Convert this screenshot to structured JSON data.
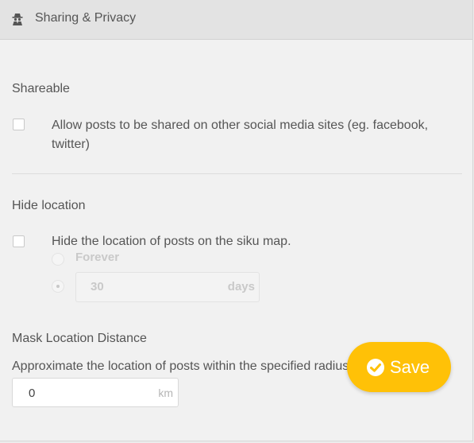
{
  "header": {
    "title": "Sharing & Privacy",
    "icon": "spy-icon"
  },
  "shareable": {
    "title": "Shareable",
    "checkbox_label_line1": "Allow posts to be shared on other social media sites (eg. facebook,",
    "checkbox_label_line2": "twitter)",
    "checked": false
  },
  "hide_location": {
    "title": "Hide location",
    "checkbox_label": "Hide the location of posts on the siku map.",
    "checked": false,
    "option_forever": "Forever",
    "days_value": "30",
    "days_unit": "days"
  },
  "mask_distance": {
    "title": "Mask Location Distance",
    "description": "Approximate the location of posts within the specified radius",
    "value": "0",
    "unit": "km"
  },
  "save_button": {
    "label": "Save",
    "icon": "check-circle-icon",
    "color": "#ffc107"
  }
}
